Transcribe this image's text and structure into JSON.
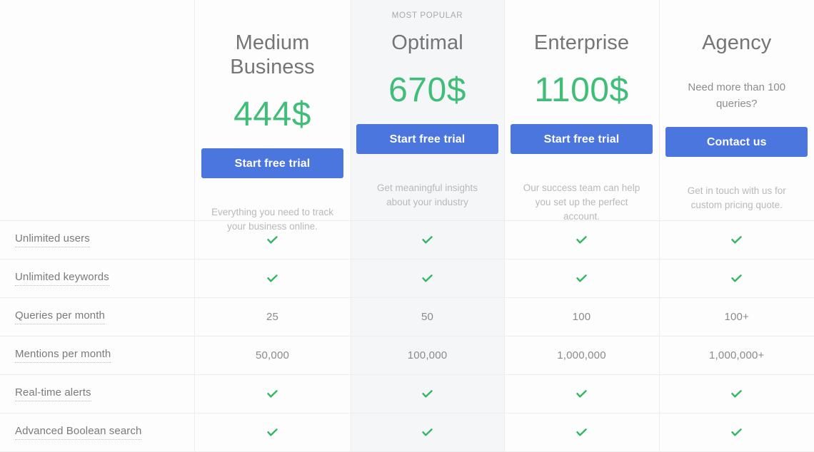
{
  "colors": {
    "cta": "#4a76de",
    "price": "#40be77",
    "check": "#34b764",
    "plan_name": "#757575",
    "description": "#b9b9b9",
    "featured_background": "#f5f6f8"
  },
  "badge": {
    "most_popular": "MOST POPULAR"
  },
  "plans": [
    {
      "id": "medium-business",
      "name": "Medium Business",
      "price": "444$",
      "price_note": null,
      "cta_label": "Start free trial",
      "description": "Everything you need to track your business online.",
      "featured": false,
      "badge": null
    },
    {
      "id": "optimal",
      "name": "Optimal",
      "price": "670$",
      "price_note": null,
      "cta_label": "Start free trial",
      "description": "Get meaningful insights about your industry",
      "featured": true,
      "badge": "MOST POPULAR"
    },
    {
      "id": "enterprise",
      "name": "Enterprise",
      "price": "1100$",
      "price_note": null,
      "cta_label": "Start free trial",
      "description": "Our success team can help you set up the perfect account.",
      "featured": false,
      "badge": null
    },
    {
      "id": "agency",
      "name": "Agency",
      "price": null,
      "price_note": "Need more than 100 queries?",
      "cta_label": "Contact us",
      "description": "Get in touch with us for custom pricing quote.",
      "featured": false,
      "badge": null
    }
  ],
  "features": [
    {
      "label": "Unlimited users",
      "values": [
        "check",
        "check",
        "check",
        "check"
      ]
    },
    {
      "label": "Unlimited keywords",
      "values": [
        "check",
        "check",
        "check",
        "check"
      ]
    },
    {
      "label": "Queries per month",
      "values": [
        "25",
        "50",
        "100",
        "100+"
      ]
    },
    {
      "label": "Mentions per month",
      "values": [
        "50,000",
        "100,000",
        "1,000,000",
        "1,000,000+"
      ]
    },
    {
      "label": "Real-time alerts",
      "values": [
        "check",
        "check",
        "check",
        "check"
      ]
    },
    {
      "label": "Advanced Boolean search",
      "values": [
        "check",
        "check",
        "check",
        "check"
      ]
    }
  ]
}
